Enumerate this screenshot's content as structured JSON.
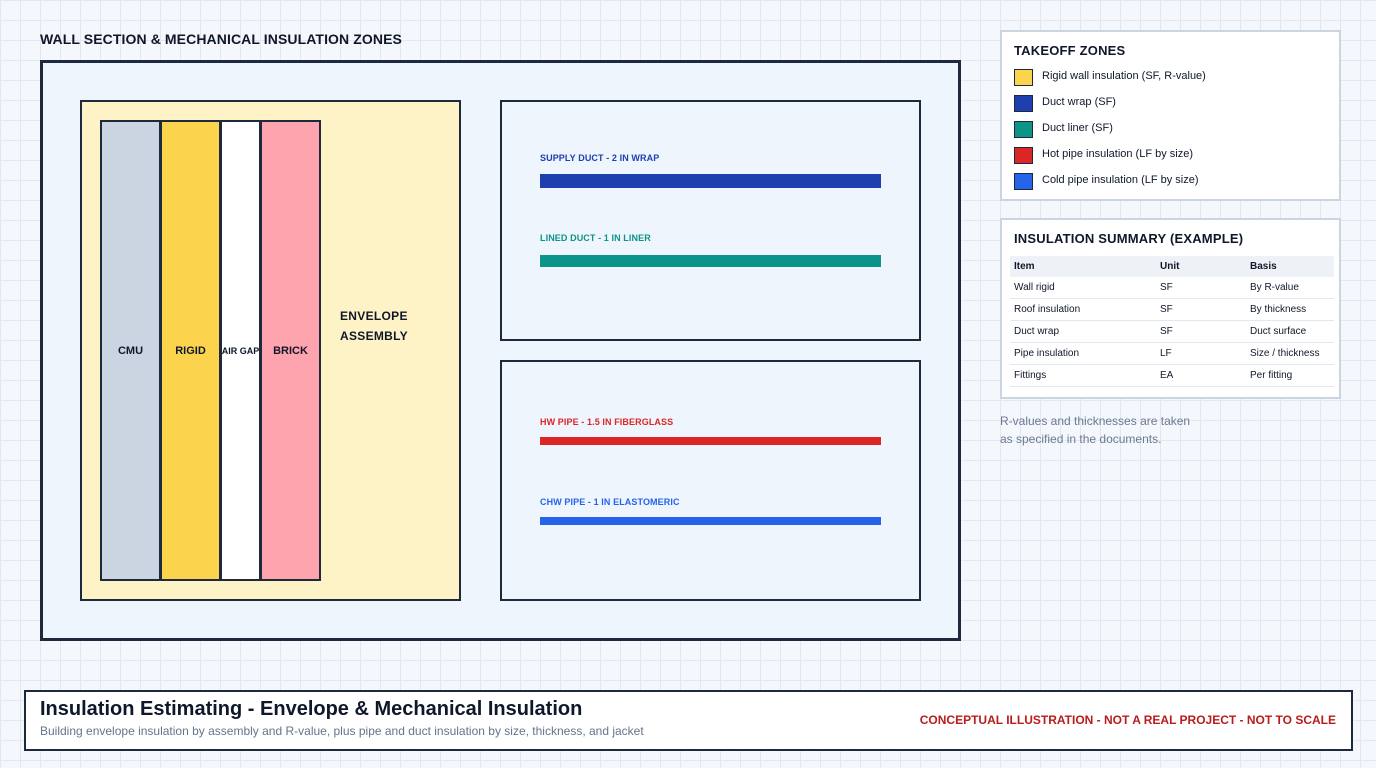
{
  "diagram": {
    "title": "WALL SECTION & MECHANICAL INSULATION ZONES",
    "wall_layers": [
      {
        "label": "CMU",
        "color": "#cbd5e1"
      },
      {
        "label": "RIGID",
        "color": "#fcd34d"
      },
      {
        "label": "AIR GAP",
        "color": "#ffffff"
      },
      {
        "label": "BRICK",
        "color": "#fda4af"
      }
    ],
    "envelope_label_line1": "ENVELOPE",
    "envelope_label_line2": "ASSEMBLY",
    "duct_runs": [
      {
        "label": "SUPPLY DUCT - 2 IN WRAP",
        "color": "#1e40af"
      },
      {
        "label": "LINED DUCT - 1 IN LINER",
        "color": "#0d9488"
      }
    ],
    "pipe_runs": [
      {
        "label": "HW PIPE - 1.5 IN FIBERGLASS",
        "color": "#dc2626"
      },
      {
        "label": "CHW PIPE - 1 IN ELASTOMERIC",
        "color": "#2563eb"
      }
    ]
  },
  "takeoff_zones": {
    "title": "TAKEOFF ZONES",
    "items": [
      {
        "label": "Rigid wall insulation (SF, R-value)",
        "color": "#fcd34d"
      },
      {
        "label": "Duct wrap (SF)",
        "color": "#1e40af"
      },
      {
        "label": "Duct liner (SF)",
        "color": "#0d9488"
      },
      {
        "label": "Hot pipe insulation (LF by size)",
        "color": "#dc2626"
      },
      {
        "label": "Cold pipe insulation (LF by size)",
        "color": "#2563eb"
      }
    ]
  },
  "summary": {
    "title": "INSULATION SUMMARY (EXAMPLE)",
    "headers": [
      "Item",
      "Unit",
      "Basis"
    ],
    "rows": [
      [
        "Wall rigid",
        "SF",
        "By R-value"
      ],
      [
        "Roof insulation",
        "SF",
        "By thickness"
      ],
      [
        "Duct wrap",
        "SF",
        "Duct surface"
      ],
      [
        "Pipe insulation",
        "LF",
        "Size / thickness"
      ],
      [
        "Fittings",
        "EA",
        "Per fitting"
      ]
    ]
  },
  "note": {
    "line1": "R-values and thicknesses are taken",
    "line2": "as specified in the documents."
  },
  "footer": {
    "title": "Insulation Estimating - Envelope & Mechanical Insulation",
    "subtitle": "Building envelope insulation by assembly and R-value, plus pipe and duct insulation by size, thickness, and jacket",
    "flag": "CONCEPTUAL ILLUSTRATION - NOT A REAL PROJECT - NOT TO SCALE",
    "flag_color": "#b91c1c"
  }
}
